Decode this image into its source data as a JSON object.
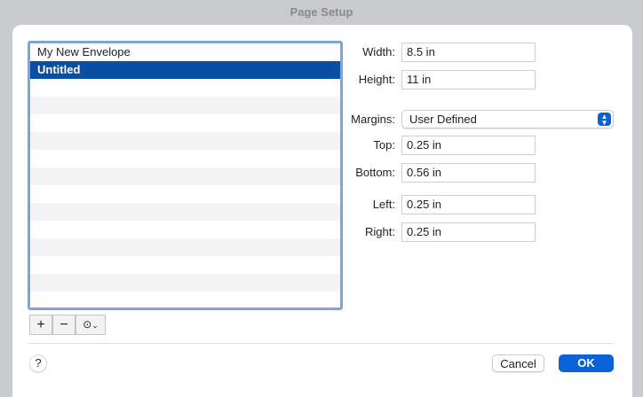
{
  "window": {
    "title": "Page Setup"
  },
  "list": {
    "items": [
      "My New Envelope",
      "Untitled"
    ],
    "selected": "Untitled"
  },
  "fields": {
    "width": {
      "label": "Width:",
      "value": "8.5 in"
    },
    "height": {
      "label": "Height:",
      "value": "11 in"
    },
    "margins": {
      "label": "Margins:",
      "value": "User Defined"
    },
    "top": {
      "label": "Top:",
      "value": "0.25 in"
    },
    "bottom": {
      "label": "Bottom:",
      "value": "0.56 in"
    },
    "left": {
      "label": "Left:",
      "value": "0.25 in"
    },
    "right": {
      "label": "Right:",
      "value": "0.25 in"
    }
  },
  "toolbar": {
    "add": "+",
    "remove": "−",
    "help": "?"
  },
  "buttons": {
    "cancel": "Cancel",
    "ok": "OK"
  }
}
